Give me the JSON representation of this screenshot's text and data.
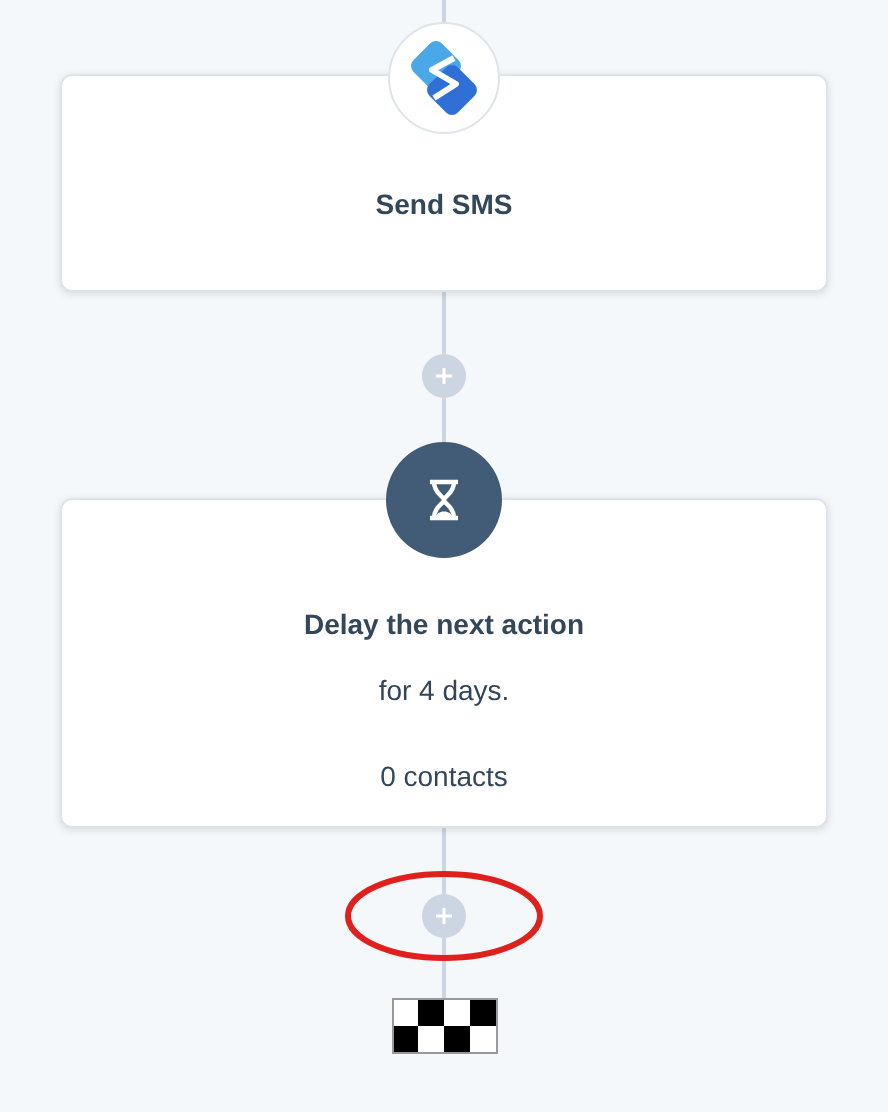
{
  "steps": [
    {
      "kind": "sms",
      "title": "Send SMS"
    },
    {
      "kind": "delay",
      "title": "Delay the next action",
      "details": [
        "for 4 days.",
        "0 contacts"
      ]
    }
  ],
  "add_buttons": [
    {
      "highlighted": false
    },
    {
      "highlighted": true
    }
  ]
}
